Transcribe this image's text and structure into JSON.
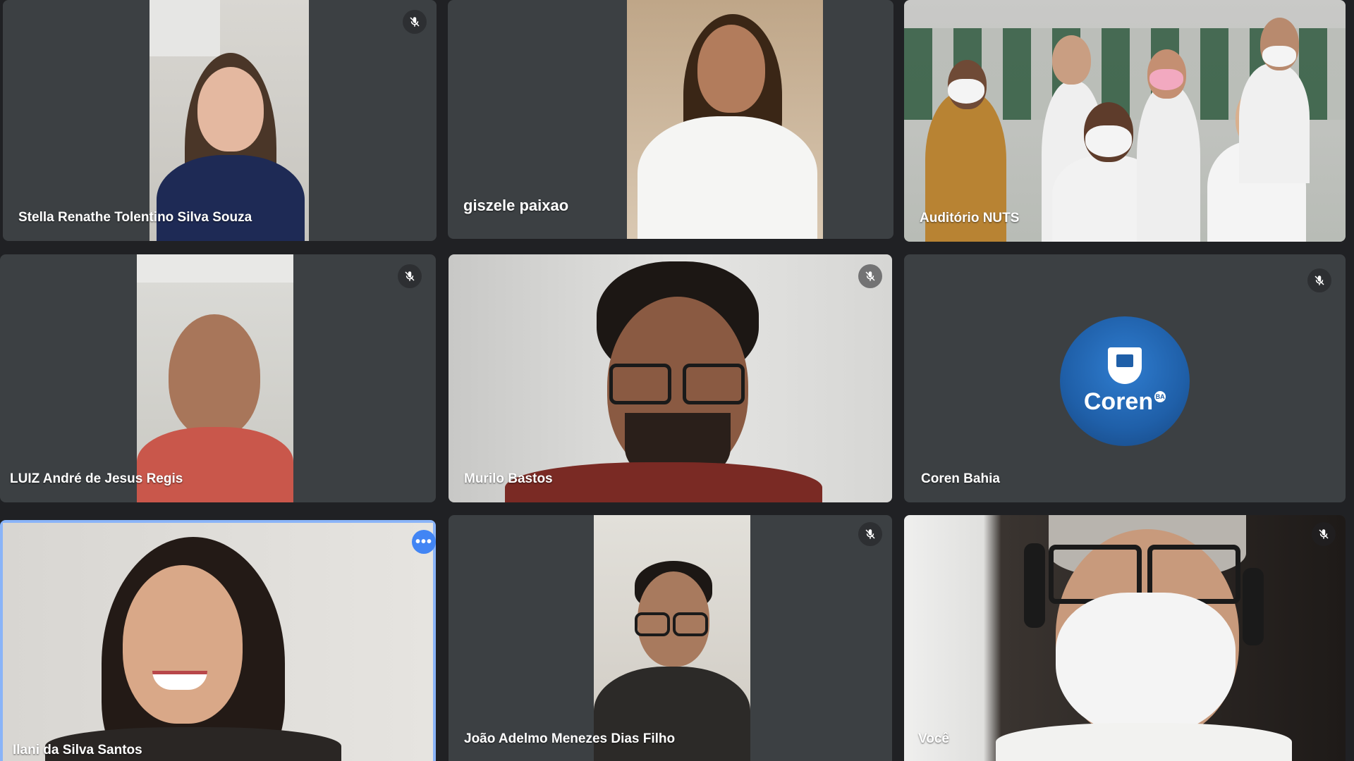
{
  "meeting": {
    "participants": [
      {
        "name": "Stella Renathe Tolentino Silva Souza",
        "muted": true
      },
      {
        "name": "giszele paixao",
        "muted": false
      },
      {
        "name": "Auditório NUTS",
        "muted": false
      },
      {
        "name": "LUIZ André de Jesus Regis",
        "muted": true
      },
      {
        "name": "Murilo Bastos",
        "muted": true
      },
      {
        "name": "Coren Bahia",
        "muted": true,
        "avatar_text": "Coren",
        "avatar_badge": "BA"
      },
      {
        "name": "Ilani da Silva Santos",
        "muted": false,
        "speaking": true
      },
      {
        "name": "João Adelmo Menezes Dias Filho",
        "muted": true
      },
      {
        "name": "Você",
        "muted": true
      }
    ],
    "more_options_label": "•••"
  },
  "colors": {
    "background": "#202124",
    "tile": "#3c4043",
    "accent": "#4285f4",
    "coren_avatar": "#1f5fa8"
  },
  "icons": {
    "muted": "mic-off-icon",
    "more": "more-options-icon"
  }
}
